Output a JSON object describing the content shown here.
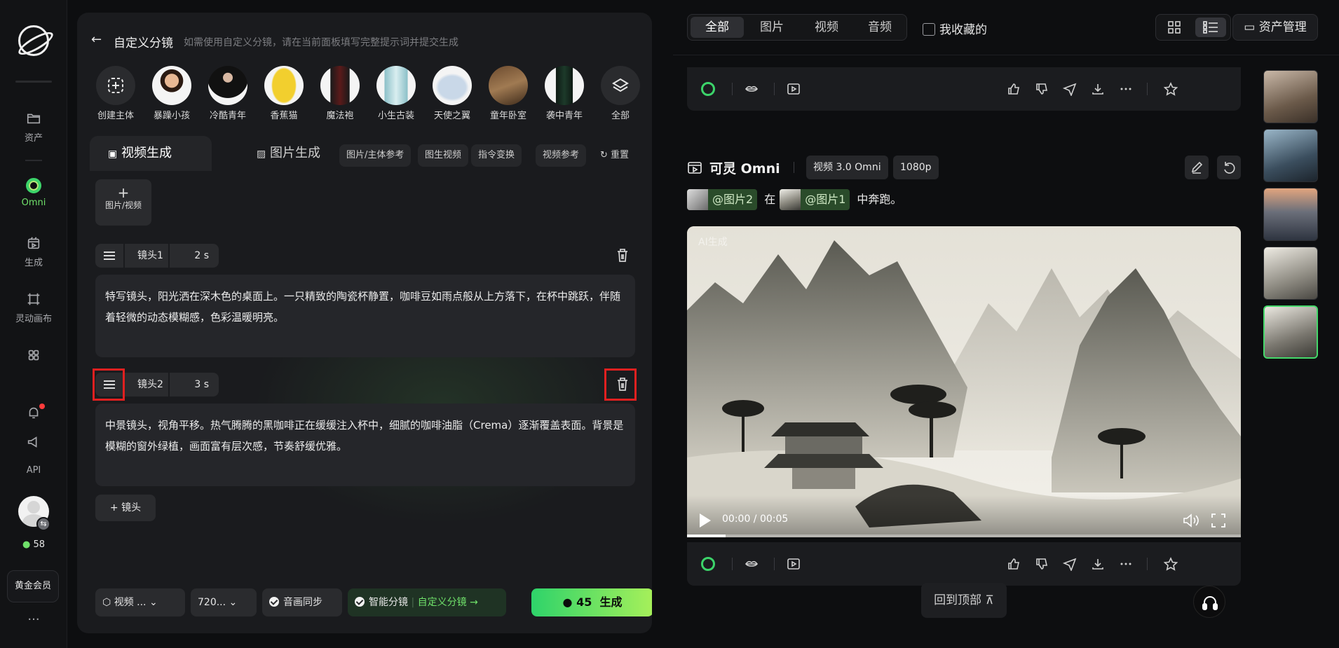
{
  "rail": {
    "items": [
      {
        "label": "资产",
        "icon": "folder-icon"
      },
      {
        "label": "Omni",
        "icon": "omni-icon"
      },
      {
        "label": "生成",
        "icon": "generate-icon"
      },
      {
        "label": "灵动画布",
        "icon": "canvas-icon"
      },
      {
        "label": "",
        "icon": "apps-icon"
      }
    ],
    "api_label": "API",
    "credits": "58",
    "vip_label": "黄金会员",
    "more_label": "···"
  },
  "panel": {
    "title": "自定义分镜",
    "hint": "如需使用自定义分镜，请在当前面板填写完整提示词并提交生成",
    "subjects": [
      {
        "label": "创建主体"
      },
      {
        "label": "暴躁小孩"
      },
      {
        "label": "冷酷青年"
      },
      {
        "label": "香蕉猫"
      },
      {
        "label": "魔法袍"
      },
      {
        "label": "小生古装"
      },
      {
        "label": "天使之翼"
      },
      {
        "label": "童年卧室"
      },
      {
        "label": "袭中青年"
      },
      {
        "label": "全部"
      }
    ],
    "tabs": {
      "video": "视频生成",
      "image": "图片生成"
    },
    "chips": [
      "图片/主体参考",
      "图生视频",
      "指令变换",
      "视频参考"
    ],
    "reset_label": "重置",
    "upload_label": "图片/视频",
    "shots": [
      {
        "name": "镜头1",
        "duration": "2 s",
        "text": "特写镜头，阳光洒在深木色的桌面上。一只精致的陶瓷杯静置，咖啡豆如雨点般从上方落下，在杯中跳跃，伴随着轻微的动态模糊感，色彩温暖明亮。"
      },
      {
        "name": "镜头2",
        "duration": "3 s",
        "text": "中景镜头，视角平移。热气腾腾的黑咖啡正在缓缓注入杯中，细腻的咖啡油脂（Crema）逐渐覆盖表面。背景是模糊的窗外绿植，画面富有层次感，节奏舒缓优雅。"
      }
    ],
    "add_shot_label": "镜头",
    "bottom": {
      "mode": "视频 ...",
      "resolution": "720...",
      "audio_sync": "音画同步",
      "smart_shot": "智能分镜",
      "custom_shot": "自定义分镜 →",
      "cost": "45",
      "generate": "生成"
    }
  },
  "top": {
    "filters": [
      "全部",
      "图片",
      "视频",
      "音频"
    ],
    "favorites": "我收藏的",
    "asset_manage": "资产管理"
  },
  "card": {
    "title": "可灵 Omni",
    "model": "视频 3.0 Omni",
    "resolution": "1080p",
    "prompt": {
      "ref1": "@图片2",
      "mid": "在",
      "ref2": "@图片1",
      "tail": "中奔跑。"
    },
    "watermark": "AI生成",
    "time": "00:00 / 00:05",
    "video_progress": 0.07
  },
  "back_to_top": "回到顶部 ⊼",
  "colors": {
    "accent": "#6fe06a",
    "highlight_box": "#e02020",
    "tag_bg": "#2a4b2a"
  }
}
